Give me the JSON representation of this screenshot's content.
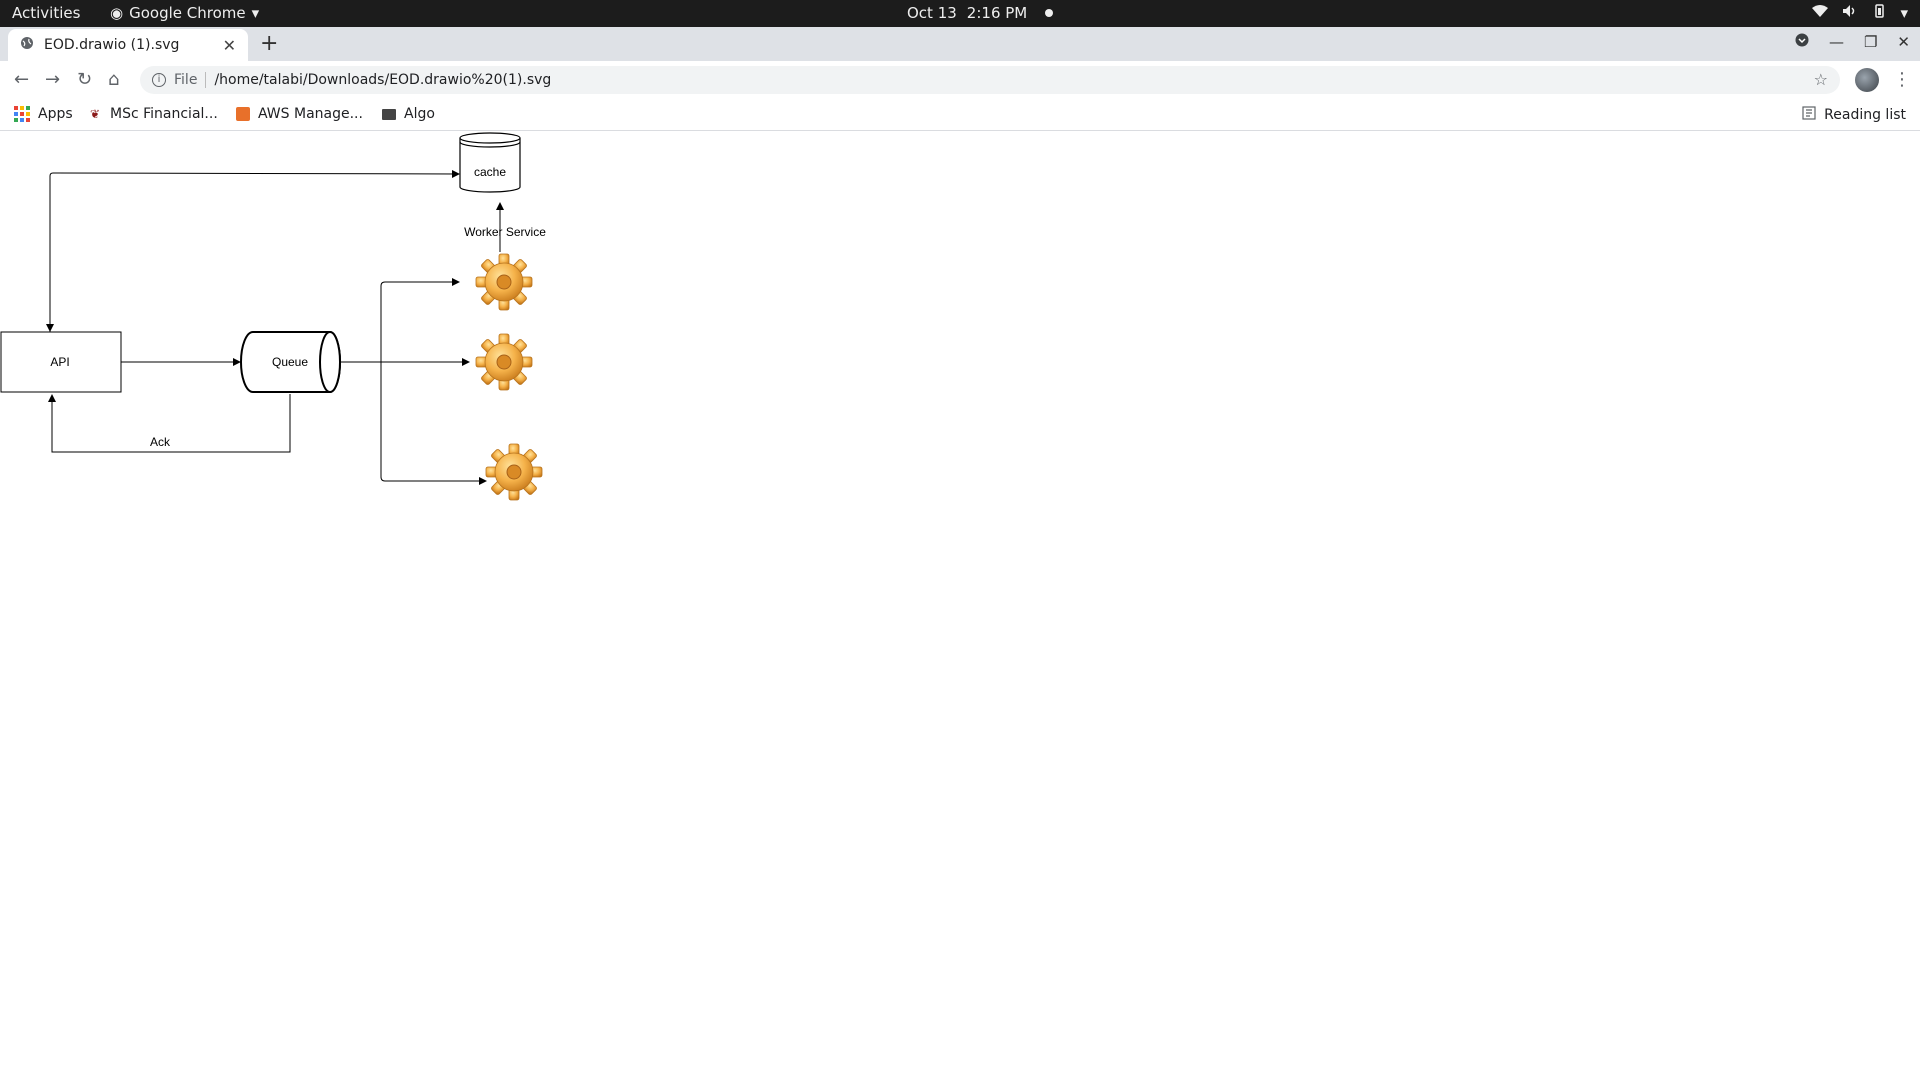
{
  "system_bar": {
    "activities": "Activities",
    "app_name": "Google Chrome",
    "date": "Oct 13",
    "time": "2:16 PM"
  },
  "browser": {
    "tab_title": "EOD.drawio (1).svg",
    "address_scheme": "File",
    "url": "/home/talabi/Downloads/EOD.drawio%20(1).svg",
    "bookmarks": [
      "Apps",
      "MSc Financial...",
      "AWS Manage...",
      "Algo"
    ],
    "reading_list": "Reading list"
  },
  "diagram": {
    "nodes": {
      "cache": "cache",
      "api": "API",
      "queue": "Queue",
      "worker_label": "Worker Service"
    },
    "edge_labels": {
      "ack": "Ack"
    },
    "worker_count": 3
  },
  "icons": [
    "chrome-icon",
    "globe-icon",
    "gear-icon",
    "star-icon",
    "reading-list-icon",
    "wifi-icon",
    "volume-icon",
    "battery-icon"
  ]
}
